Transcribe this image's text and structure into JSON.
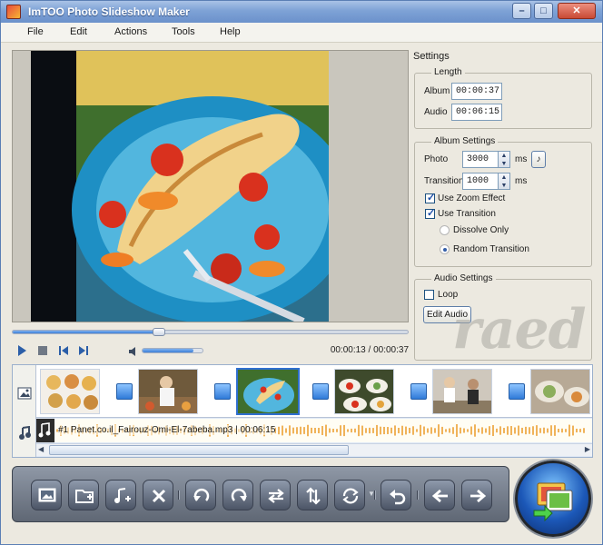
{
  "window": {
    "title": "ImTOO Photo Slideshow Maker"
  },
  "menu": [
    "File",
    "Edit",
    "Actions",
    "Tools",
    "Help"
  ],
  "playback": {
    "time_readout": "00:00:13 / 00:00:37",
    "progress": 0.37,
    "volume": 0.85
  },
  "settings": {
    "title": "Settings",
    "length": {
      "legend": "Length",
      "album_label": "Album",
      "album_value": "00:00:37",
      "audio_label": "Audio",
      "audio_value": "00:06:15"
    },
    "album": {
      "legend": "Album Settings",
      "photo_label": "Photo",
      "photo_value": "3000",
      "transition_label": "Transition",
      "transition_value": "1000",
      "unit_ms": "ms",
      "zoom_label": "Use Zoom Effect",
      "zoom_checked": true,
      "use_transition_label": "Use Transition",
      "use_transition_checked": true,
      "dissolve_label": "Dissolve Only",
      "random_label": "Random Transition",
      "selected_transition": "random"
    },
    "audio": {
      "legend": "Audio Settings",
      "loop_label": "Loop",
      "loop_checked": false,
      "edit_audio_label": "Edit Audio"
    }
  },
  "storyboard": {
    "audio_track_label": "#1 Panet.co.il_Fairouz-Omi-El-7abeba.mp3 | 00:06:15",
    "selected_index": 2
  },
  "watermark_text": "raed"
}
